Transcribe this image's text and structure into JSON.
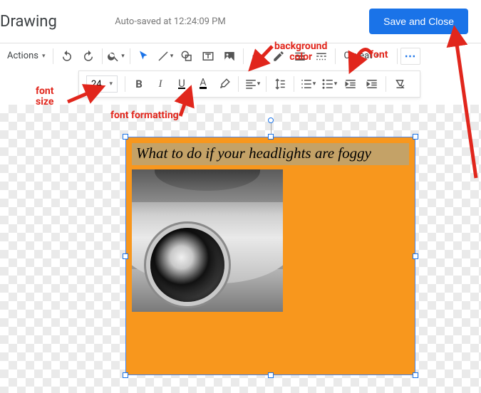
{
  "header": {
    "title": "Drawing",
    "autosave": "Auto-saved at 12:24:09 PM",
    "save_button": "Save and Close"
  },
  "toolbar1": {
    "actions": "Actions",
    "font_name": "Caveat",
    "more": "⋯"
  },
  "toolbar2": {
    "font_size": "24"
  },
  "canvas": {
    "headline_text": "What to do if your headlights are foggy"
  },
  "annotations": {
    "bg_color": "background color",
    "font": "font",
    "font_size": "font size",
    "font_formatting": "font formatting"
  }
}
